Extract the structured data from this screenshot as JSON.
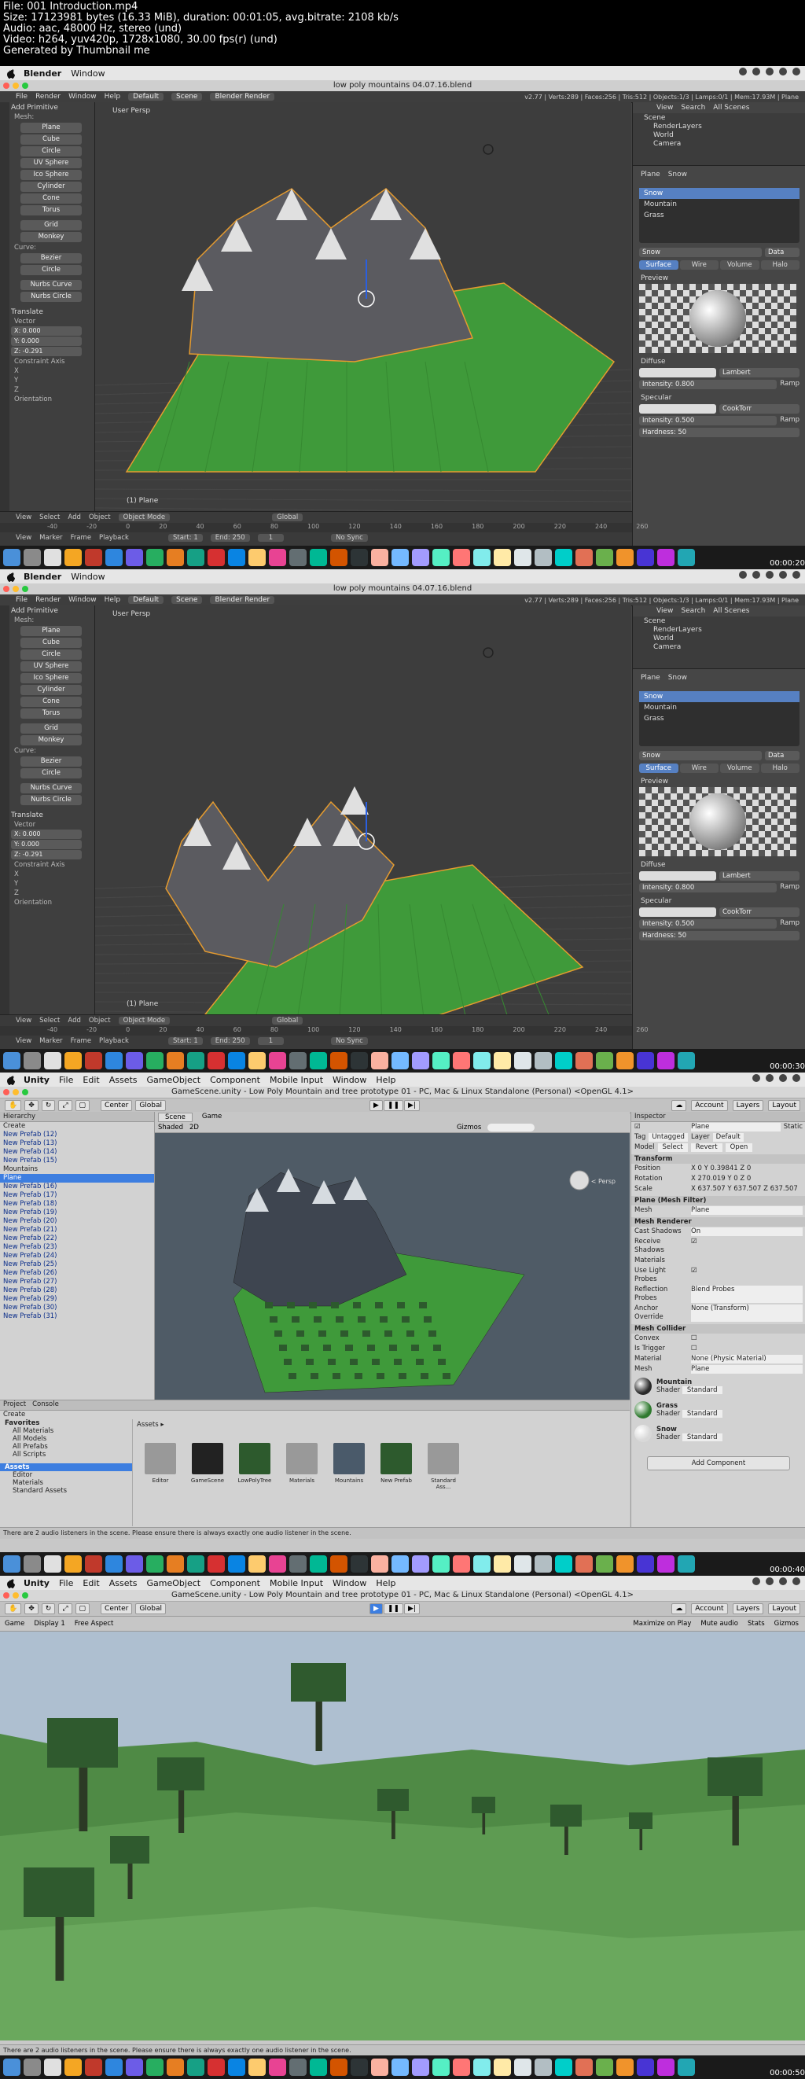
{
  "header": {
    "line1": "File: 001 Introduction.mp4",
    "line2": "Size: 17123981 bytes (16.33 MiB), duration: 00:01:05, avg.bitrate: 2108 kb/s",
    "line3": "Audio: aac, 48000 Hz, stereo (und)",
    "line4": "Video: h264, yuv420p, 1728x1080, 30.00 fps(r) (und)",
    "line5": "Generated by Thumbnail me"
  },
  "blender": {
    "app": "Blender",
    "menu_window": "Window",
    "title": "low poly mountains 04.07.16.blend",
    "menu": [
      "File",
      "Render",
      "Window",
      "Help"
    ],
    "layout": "Default",
    "scene": "Scene",
    "engine": "Blender Render",
    "info": "v2.77 | Verts:289 | Faces:256 | Tris:512 | Objects:1/3 | Lamps:0/1 | Mem:17.93M | Plane",
    "add_primitive": "Add Primitive",
    "mesh_label": "Mesh:",
    "mesh_items": [
      "Plane",
      "Cube",
      "Circle",
      "UV Sphere",
      "Ico Sphere",
      "Cylinder",
      "Cone",
      "Torus"
    ],
    "mesh_items2": [
      "Grid",
      "Monkey"
    ],
    "curve_label": "Curve:",
    "curve_items": [
      "Bezier",
      "Circle",
      "Nurbs Curve",
      "Nurbs Circle"
    ],
    "translate": "Translate",
    "vector": "Vector",
    "vec_x": "X:  0.000",
    "vec_y": "Y:  0.000",
    "vec_z": "Z:  -0.291",
    "constraint_axis": "Constraint Axis",
    "orientation": "Orientation",
    "view_label": "User Persp",
    "object_label": "(1) Plane",
    "view_menu": [
      "View",
      "Select",
      "Add",
      "Object"
    ],
    "mode": "Object Mode",
    "global": "Global",
    "timeline": [
      "View",
      "Marker",
      "Frame",
      "Playback"
    ],
    "start": "Start:   1",
    "end": "End:   250",
    "frame": "1",
    "nosync": "No Sync",
    "ruler": [
      "-40",
      "-20",
      "0",
      "20",
      "40",
      "60",
      "80",
      "100",
      "120",
      "140",
      "160",
      "180",
      "200",
      "220",
      "240",
      "260"
    ],
    "outliner_menu": [
      "View",
      "Search",
      "All Scenes"
    ],
    "outliner": [
      "Scene",
      "RenderLayers",
      "World",
      "Camera"
    ],
    "obj_crumb": "Plane",
    "mat_crumb": "Snow",
    "materials": [
      "Snow",
      "Mountain",
      "Grass"
    ],
    "mat_field": "Snow",
    "data_btn": "Data",
    "mat_tabs": [
      "Surface",
      "Wire",
      "Volume",
      "Halo"
    ],
    "preview": "Preview",
    "diffuse": "Diffuse",
    "lambert": "Lambert",
    "intensity_d": "Intensity: 0.800",
    "ramp": "Ramp",
    "specular": "Specular",
    "cooktorr": "CookTorr",
    "intensity_s": "Intensity: 0.500",
    "hardness": "Hardness:",
    "hardness_val": "50",
    "stamp1": "00:00:20",
    "stamp2": "00:00:30"
  },
  "unity": {
    "app": "Unity",
    "menu": [
      "File",
      "Edit",
      "Assets",
      "GameObject",
      "Component",
      "Mobile Input",
      "Window",
      "Help"
    ],
    "title": "GameScene.unity - Low Poly Mountain and tree prototype 01 - PC, Mac & Linux Standalone (Personal) <OpenGL 4.1>",
    "center": "Center",
    "global": "Global",
    "account": "Account",
    "layers": "Layers",
    "layout": "Layout",
    "hierarchy": "Hierarchy",
    "create": "Create",
    "hier_items": [
      "New Prefab (12)",
      "New Prefab (13)",
      "New Prefab (14)",
      "New Prefab (15)",
      "Mountains",
      "Plane",
      "New Prefab (16)",
      "New Prefab (17)",
      "New Prefab (18)",
      "New Prefab (19)",
      "New Prefab (20)",
      "New Prefab (21)",
      "New Prefab (22)",
      "New Prefab (23)",
      "New Prefab (24)",
      "New Prefab (25)",
      "New Prefab (26)",
      "New Prefab (27)",
      "New Prefab (28)",
      "New Prefab (29)",
      "New Prefab (30)",
      "New Prefab (31)"
    ],
    "scene_tab": "Scene",
    "game_tab": "Game",
    "shaded": "Shaded",
    "twod": "2D",
    "gizmos": "Gizmos",
    "persp": "< Persp",
    "inspector": "Inspector",
    "obj_name": "Plane",
    "static": "Static",
    "tag": "Tag",
    "tag_val": "Untagged",
    "layer": "Layer",
    "layer_val": "Default",
    "model": "Model",
    "model_btns": [
      "Select",
      "Revert",
      "Open"
    ],
    "transform": "Transform",
    "position": "Position",
    "position_val": "X 0   Y 0.39841   Z 0",
    "rotation": "Rotation",
    "rotation_val": "X 270.019   Y 0   Z 0",
    "scale": "Scale",
    "scale_val": "X 637.507   Y 637.507   Z 637.507",
    "mesh_filter": "Plane (Mesh Filter)",
    "mesh": "Mesh",
    "mesh_val": "Plane",
    "mesh_renderer": "Mesh Renderer",
    "cast_shadows": "Cast Shadows",
    "cast_val": "On",
    "receive_shadows": "Receive Shadows",
    "materials": "Materials",
    "use_light_probes": "Use Light Probes",
    "reflection_probes": "Reflection Probes",
    "reflection_val": "Blend Probes",
    "anchor_override": "Anchor Override",
    "anchor_val": "None (Transform)",
    "mesh_collider": "Mesh Collider",
    "convex": "Convex",
    "is_trigger": "Is Trigger",
    "material": "Material",
    "material_val": "None (Physic Material)",
    "mats": [
      {
        "name": "Mountain",
        "shader": "Standard",
        "color": "#2a2a2a"
      },
      {
        "name": "Grass",
        "shader": "Standard",
        "color": "#2f7a2f"
      },
      {
        "name": "Snow",
        "shader": "Standard",
        "color": "#d8d8d8"
      }
    ],
    "shader_lbl": "Shader",
    "add_component": "Add Component",
    "project": "Project",
    "console": "Console",
    "favorites": "Favorites",
    "fav_items": [
      "All Materials",
      "All Models",
      "All Prefabs",
      "All Scripts"
    ],
    "assets_root": "Assets",
    "asset_tree": [
      "Editor",
      "Materials",
      "Standard Assets"
    ],
    "assets_header": "Assets ▸",
    "assets": [
      "Editor",
      "GameScene",
      "LowPolyTree",
      "Materials",
      "Mountains",
      "New Prefab",
      "Standard Ass..."
    ],
    "status": "There are 2 audio listeners in the scene. Please ensure there is always exactly one audio listener in the scene.",
    "game": "Game",
    "display": "Display 1",
    "aspect": "Free Aspect",
    "game_opts": [
      "Maximize on Play",
      "Mute audio",
      "Stats",
      "Gizmos"
    ],
    "stamp3": "00:00:40",
    "stamp4": "00:00:50"
  },
  "colors": {
    "grass": "#3f9a3a",
    "mountain": "#5b5b60",
    "snow": "#e0e0e0",
    "selection": "#5680c2",
    "sky": "#aebfd0"
  }
}
